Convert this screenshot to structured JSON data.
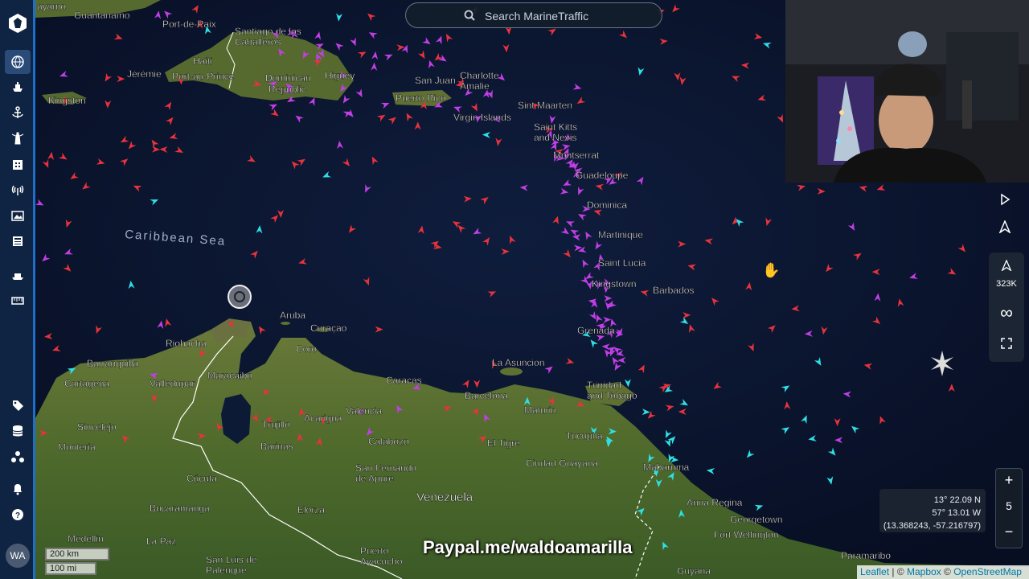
{
  "app": {
    "name": "MarineTraffic"
  },
  "search": {
    "placeholder": "Search MarineTraffic"
  },
  "sidebar": {
    "icons": [
      "globe-icon",
      "ship-icon",
      "anchor-icon",
      "lighthouse-icon",
      "building-icon",
      "antenna-icon",
      "photo-icon",
      "news-icon",
      "fleet-icon",
      "ruler-icon",
      "tag-icon",
      "database-icon",
      "network-icon",
      "bell-icon",
      "help-icon"
    ],
    "avatar_initials": "WA"
  },
  "map": {
    "sea_label": "Caribbean Sea",
    "country_labels": [
      {
        "text": "Haiti"
      },
      {
        "text": "Dominican Republic"
      },
      {
        "text": "Puerto Rico"
      },
      {
        "text": "Venezuela"
      }
    ],
    "place_labels": [
      "ayamo",
      "Guantanamo",
      "Port-de-Paix",
      "Santiago de los Caballeros",
      "Jérémie",
      "Port-au-Prince",
      "Higuey",
      "San Juan",
      "Charlotte Amalie",
      "Kingston",
      "Sint Maarten",
      "Virgin Islands",
      "Saint Kitts and Nevis",
      "Montserrat",
      "Guadeloupe",
      "Dominica",
      "Martinique",
      "Saint Lucia",
      "Kingstown",
      "Barbados",
      "Aruba",
      "Curaçao",
      "Coro",
      "Riohacha",
      "Barranquilla",
      "Cartagena",
      "Valledupar",
      "Maracaibo",
      "Grenada",
      "La Asuncion",
      "Caracas",
      "Barcelona",
      "Trinidad and Tobago",
      "Maturin",
      "Valencia",
      "Acarigua",
      "Trujillo",
      "Barinas",
      "Calabozo",
      "El Tigre",
      "Tucupita",
      "Sincelejo",
      "Monteria",
      "Ciudad Guayana",
      "San Fernando de Apure",
      "Mabaruma",
      "Cúcuta",
      "Bucaramanga",
      "Elorza",
      "Anna Regina",
      "Georgetown",
      "Fort Wellington",
      "Medellin",
      "La Paz",
      "San Luis de Palenque",
      "Puerto Ayacucho",
      "Paramaribo",
      "Guyana"
    ]
  },
  "right_controls": {
    "play_icon": "play-icon",
    "nav_icon": "navigation-icon",
    "vessel_count": "323K",
    "infinity_label": "∞",
    "fullscreen_icon": "fullscreen-icon"
  },
  "zoom": {
    "in": "+",
    "level": "5",
    "out": "−"
  },
  "coords": {
    "lat": "13° 22.09 N",
    "lon": "57° 13.01 W",
    "decimal": "(13.368243, -57.216797)"
  },
  "scale": {
    "km": "200 km",
    "mi": "100 mi"
  },
  "attribution": {
    "leaflet": "Leaflet",
    "sep1": " | © ",
    "mapbox": "Mapbox",
    "sep2": " © ",
    "osm": "OpenStreetMap"
  },
  "overlay_text": "Paypal.me/waldoamarilla",
  "colors": {
    "cargo": "#e8323c",
    "tanker": "#c23ee6",
    "passenger": "#2ee0e6",
    "sidebar": "#0f2443",
    "accent": "#1f6fc9"
  }
}
